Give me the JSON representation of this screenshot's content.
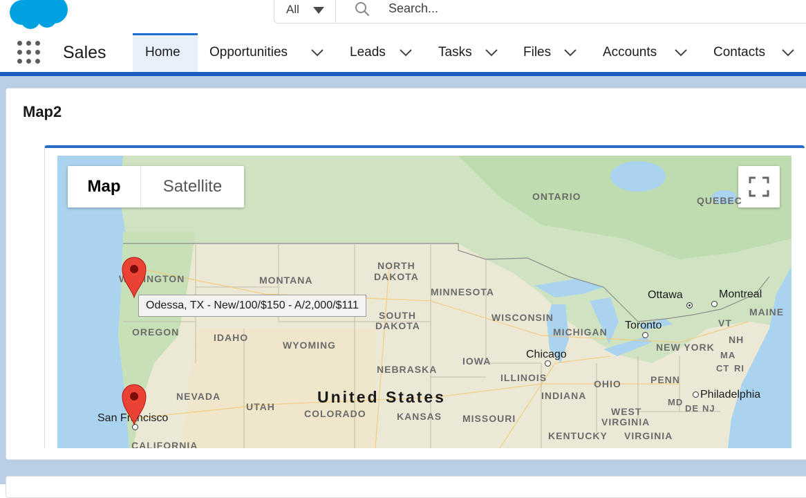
{
  "header": {
    "search": {
      "scope_value": "All",
      "placeholder": "Search..."
    }
  },
  "nav": {
    "app_name": "Sales",
    "tabs": [
      {
        "label": "Home",
        "active": true
      },
      {
        "label": "Opportunities"
      },
      {
        "label": "Leads"
      },
      {
        "label": "Tasks"
      },
      {
        "label": "Files"
      },
      {
        "label": "Accounts"
      },
      {
        "label": "Contacts"
      }
    ]
  },
  "card": {
    "title": "Map2"
  },
  "map": {
    "type_controls": {
      "map": "Map",
      "satellite": "Satellite"
    },
    "tooltip": "Odessa, TX - New/100/$150 - A/2,000/$111",
    "labels": {
      "ontario": "ONTARIO",
      "quebec": "QUEBEC",
      "north": "NORTH",
      "dakota_n": "DAKOTA",
      "washington_a": "W",
      "washington_b": "HINGTON",
      "montana": "MONTANA",
      "minnesota": "MINNESOTA",
      "south": "SOUTH",
      "dakota_s": "DAKOTA",
      "wisconsin": "WISCONSIN",
      "michigan": "MICHIGAN",
      "oregon": "OREGON",
      "idaho": "IDAHO",
      "wyoming": "WYOMING",
      "nebraska": "NEBRASKA",
      "iowa": "IOWA",
      "illinois": "ILLINOIS",
      "nevada": "NEVADA",
      "utah": "UTAH",
      "colorado": "COLORADO",
      "kansas": "KANSAS",
      "missouri": "MISSOURI",
      "indiana": "INDIANA",
      "ohio": "OHIO",
      "penn": "PENN",
      "new_york": "NEW YORK",
      "vt": "VT",
      "nh": "NH",
      "ma": "MA",
      "ct": "CT",
      "ri": "RI",
      "maine": "MAINE",
      "md": "MD",
      "de": "DE",
      "nj": "NJ",
      "west": "WEST",
      "virginia_w": "VIRGINIA",
      "virginia": "VIRGINIA",
      "kentucky": "KENTUCKY",
      "california": "CALIFORNIA",
      "country": "United States",
      "ottawa": "Ottawa",
      "montreal": "Montreal",
      "toronto": "Toronto",
      "chicago": "Chicago",
      "philadelphia": "Philadelphia",
      "san_francisco": "San Francisco"
    }
  }
}
